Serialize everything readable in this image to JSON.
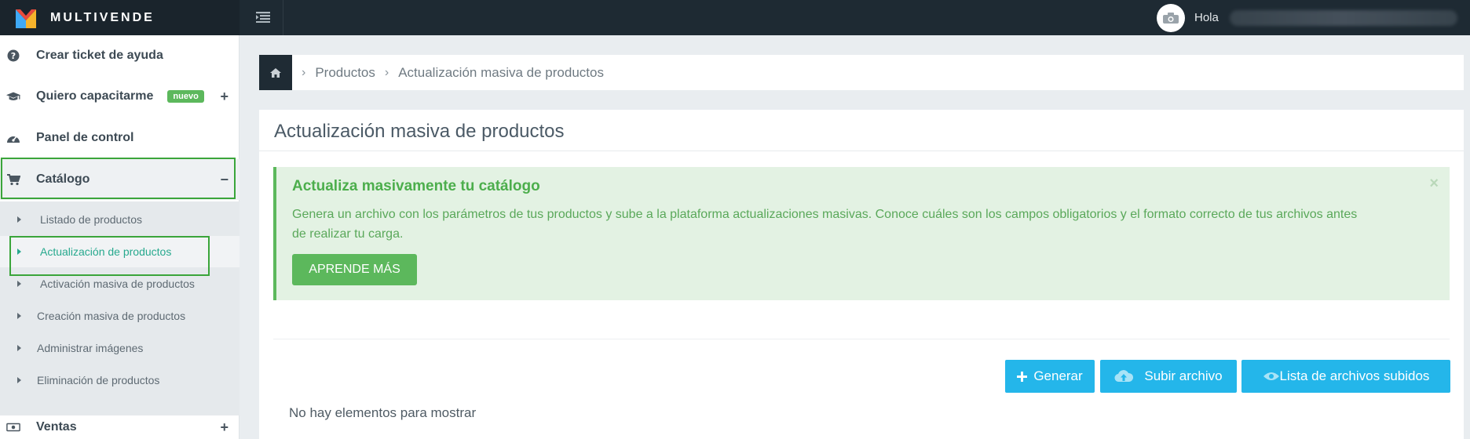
{
  "brand": {
    "name": "MULTIVENDE",
    "logo_colors": [
      "#e94b3c",
      "#f7b32b",
      "#3fa9f5",
      "#2ecc71"
    ]
  },
  "header": {
    "toggle_icon": "sidebar-toggle-icon",
    "greeting": "Hola",
    "avatar_icon": "user-avatar-icon"
  },
  "sidebar": {
    "items": [
      {
        "label": "Crear ticket de ayuda",
        "icon": "question-circle-icon"
      },
      {
        "label": "Quiero capacitarme",
        "icon": "graduation-cap-icon",
        "badge": "nuevo",
        "toggle": "+"
      },
      {
        "label": "Panel de control",
        "icon": "dashboard-icon"
      },
      {
        "label": "Catálogo",
        "icon": "cart-icon",
        "toggle": "−",
        "expanded": true
      },
      {
        "label": "Ventas",
        "icon": "money-icon",
        "toggle": "+"
      }
    ],
    "catalog_sub": [
      {
        "label": "Listado de productos"
      },
      {
        "label": "Actualización de productos",
        "active": true
      },
      {
        "label": "Activación masiva de productos"
      },
      {
        "label": "Creación masiva de productos"
      },
      {
        "label": "Administrar imágenes"
      },
      {
        "label": "Eliminación de productos"
      }
    ]
  },
  "breadcrumb": {
    "home_icon": "home-icon",
    "items": [
      "Productos",
      "Actualización masiva de productos"
    ]
  },
  "panel": {
    "title": "Actualización masiva de productos",
    "alert": {
      "title": "Actualiza masivamente tu catálogo",
      "text": "Genera un archivo con los parámetros de tus productos y sube a la plataforma actualizaciones masivas. Conoce cuáles son los campos obligatorios y el formato correcto de tus archivos antes de realizar tu carga.",
      "close": "×",
      "button": "APRENDE MÁS"
    },
    "actions": {
      "generate": "Generar",
      "upload": "Subir archivo",
      "list": "Lista de archivos subidos"
    },
    "empty_message": "No hay elementos para mostrar"
  },
  "colors": {
    "topbar": "#1e2a33",
    "accent_green": "#5cb85c",
    "accent_blue": "#24b6ea",
    "active_link": "#27a98e"
  }
}
